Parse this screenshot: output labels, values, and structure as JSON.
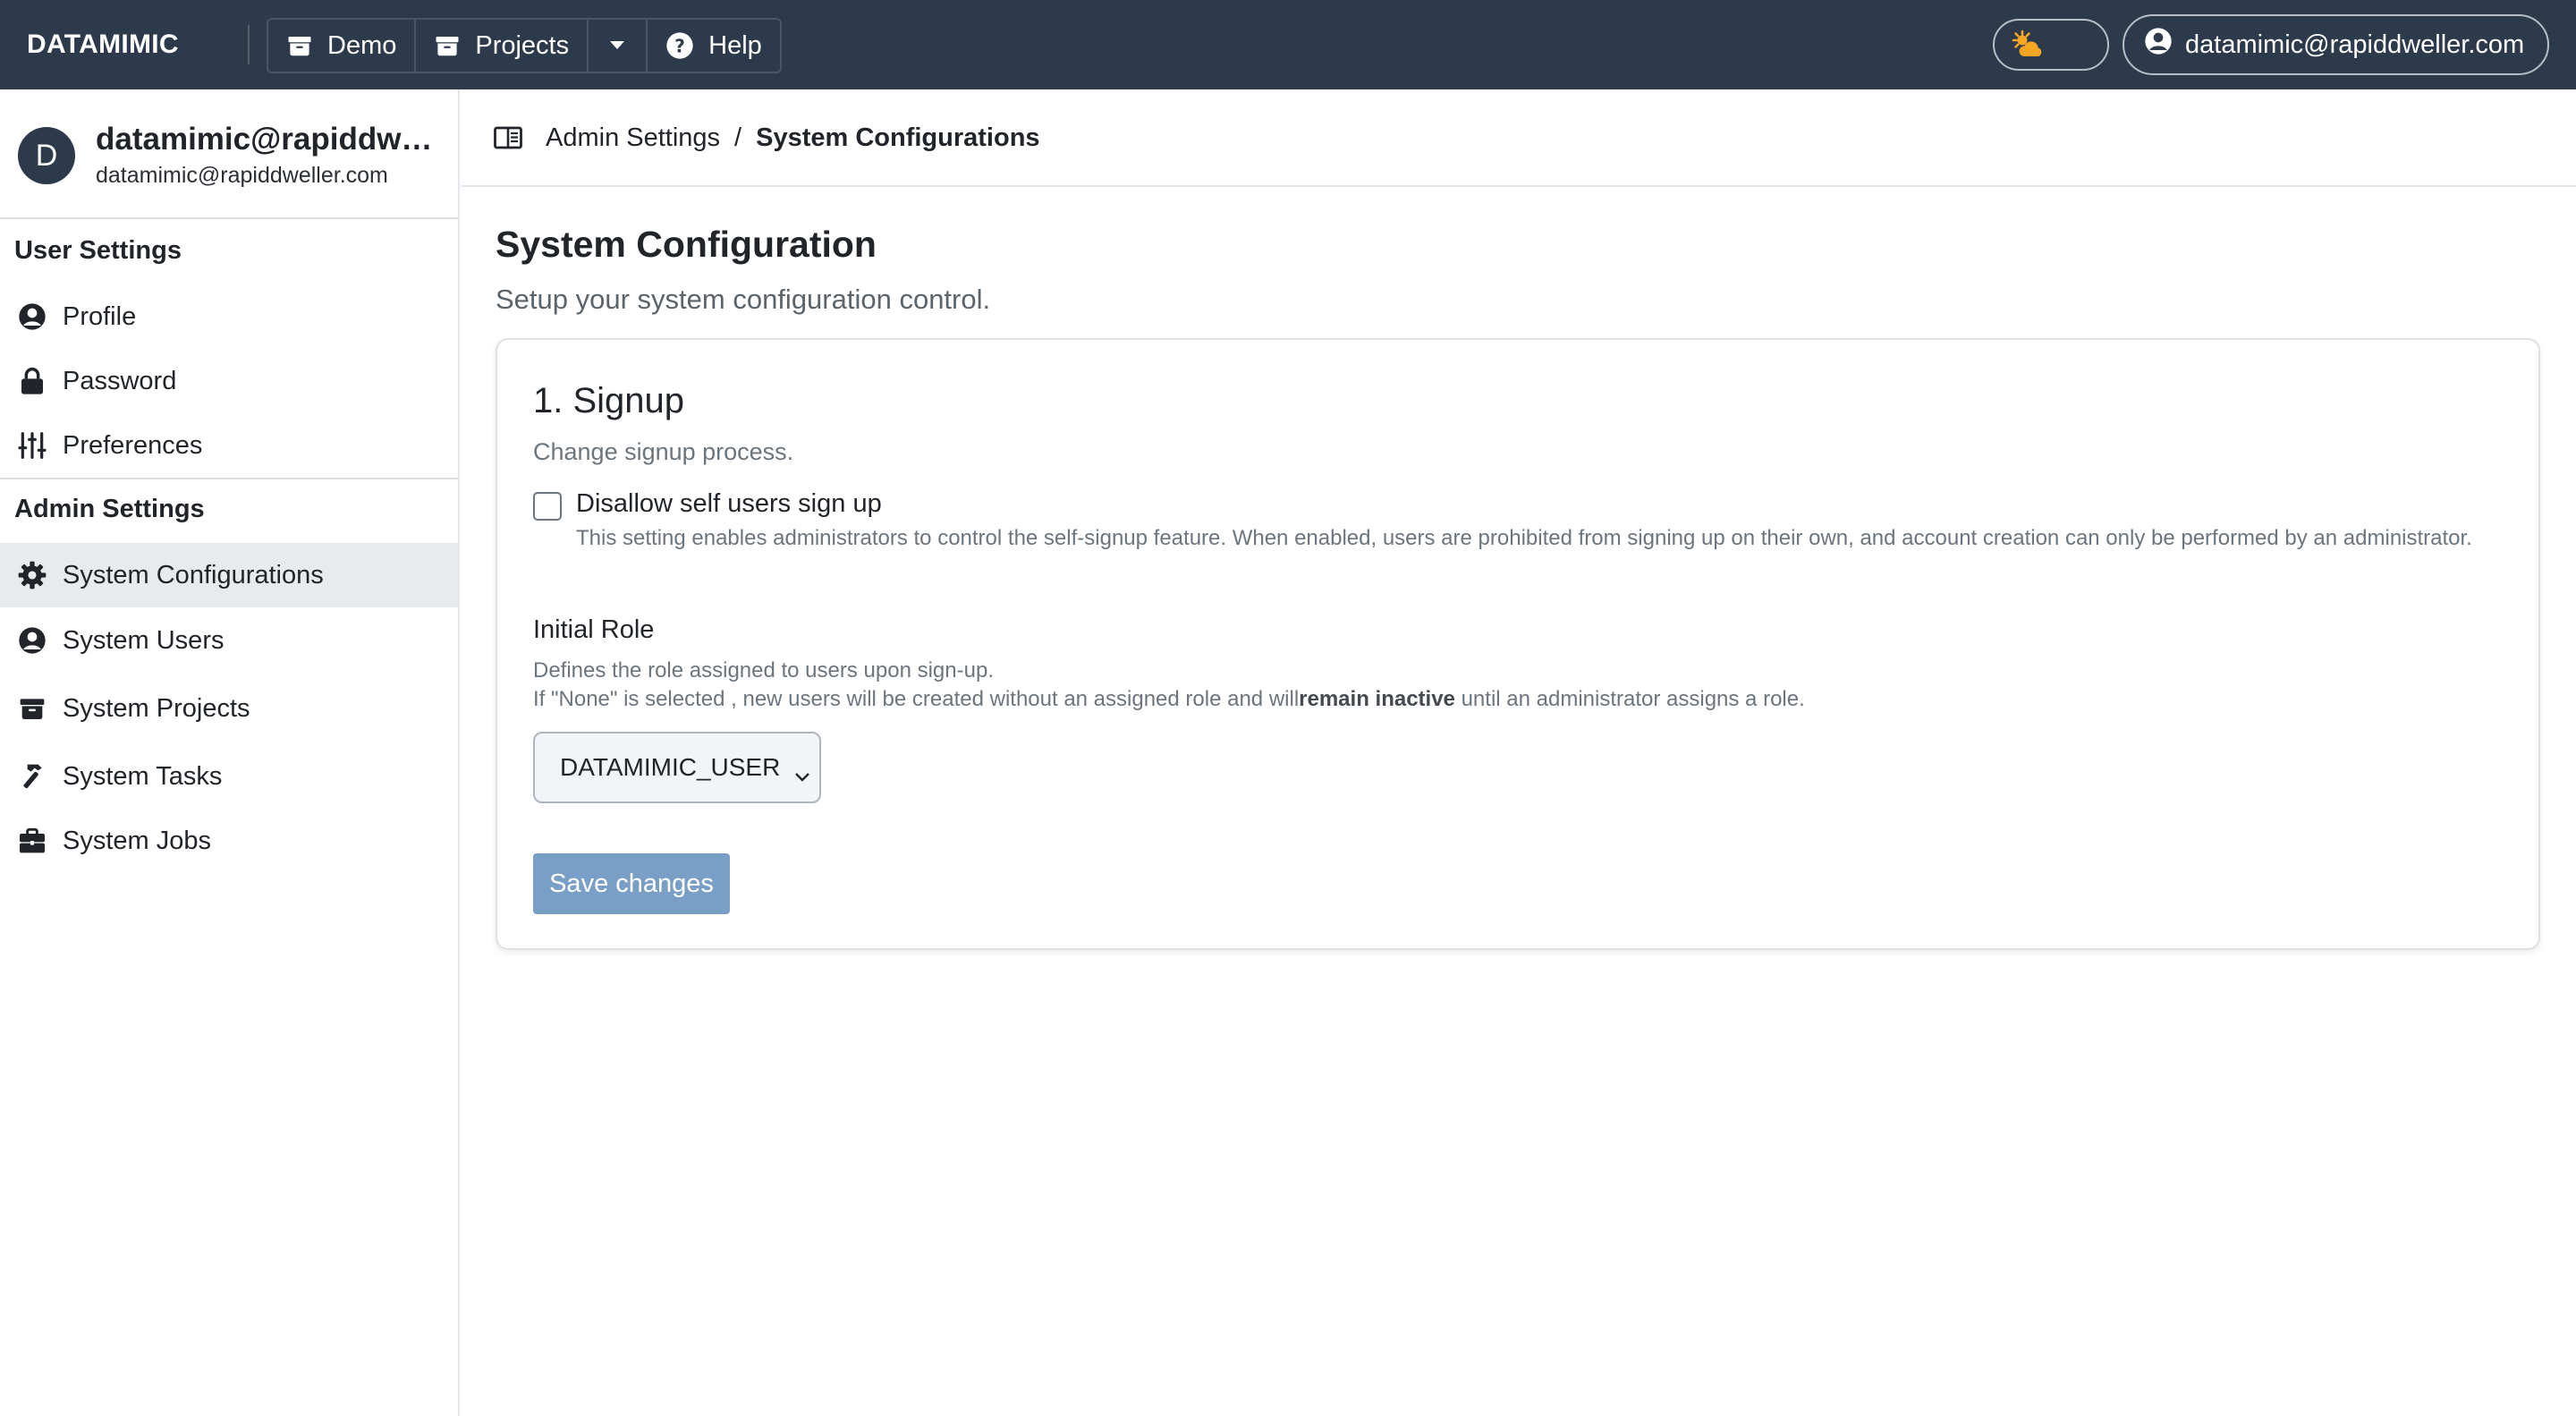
{
  "topbar": {
    "brand": "DATAMIMIC",
    "nav": [
      {
        "label": "Demo",
        "icon": "archive-box-icon"
      },
      {
        "label": "Projects",
        "icon": "archive-box-icon"
      },
      {
        "label": "",
        "icon": "caret-down-icon"
      },
      {
        "label": "Help",
        "icon": "question-circle-icon"
      }
    ],
    "theme_icon": "sun-cloud-icon",
    "user_email": "datamimic@rapiddweller.com"
  },
  "sidebar": {
    "profile": {
      "avatar_initial": "D",
      "name": "datamimic@rapiddweller.com",
      "email": "datamimic@rapiddweller.com"
    },
    "user_settings": {
      "heading": "User Settings",
      "items": [
        {
          "label": "Profile",
          "icon": "user-circle-icon"
        },
        {
          "label": "Password",
          "icon": "lock-icon"
        },
        {
          "label": "Preferences",
          "icon": "sliders-icon"
        }
      ]
    },
    "admin_settings": {
      "heading": "Admin Settings",
      "items": [
        {
          "label": "System Configurations",
          "icon": "gear-icon",
          "active": true
        },
        {
          "label": "System Users",
          "icon": "user-circle-icon"
        },
        {
          "label": "System Projects",
          "icon": "archive-box-icon"
        },
        {
          "label": "System Tasks",
          "icon": "hammer-icon"
        },
        {
          "label": "System Jobs",
          "icon": "briefcase-icon"
        }
      ]
    }
  },
  "breadcrumb": {
    "icon": "book-icon",
    "parent": "Admin Settings",
    "separator": "/",
    "current": "System Configurations"
  },
  "main": {
    "title": "System Configuration",
    "subtitle": "Setup your system configuration control.",
    "card": {
      "title": "1. Signup",
      "subtitle": "Change signup process.",
      "checkbox_label": "Disallow self users sign up",
      "checkbox_checked": false,
      "checkbox_help": "This setting enables administrators to control the self-signup feature. When enabled, users are prohibited from signing up on their own, and account creation can only be performed by an administrator.",
      "role_label": "Initial Role",
      "role_help_line1": "Defines the role assigned to users upon sign-up.",
      "role_help_line2_before": "If \"None\" is selected , new users will be created without an assigned role and will",
      "role_help_line2_bold": "remain inactive",
      "role_help_line2_after": " until an administrator assigns a role.",
      "role_selected": "DATAMIMIC_USER",
      "save_label": "Save changes"
    }
  },
  "colors": {
    "navbar": "#2c3a4b",
    "active_item": "#e8ebee",
    "save_button": "#7a9fc7",
    "theme_sun": "#f5a623"
  }
}
